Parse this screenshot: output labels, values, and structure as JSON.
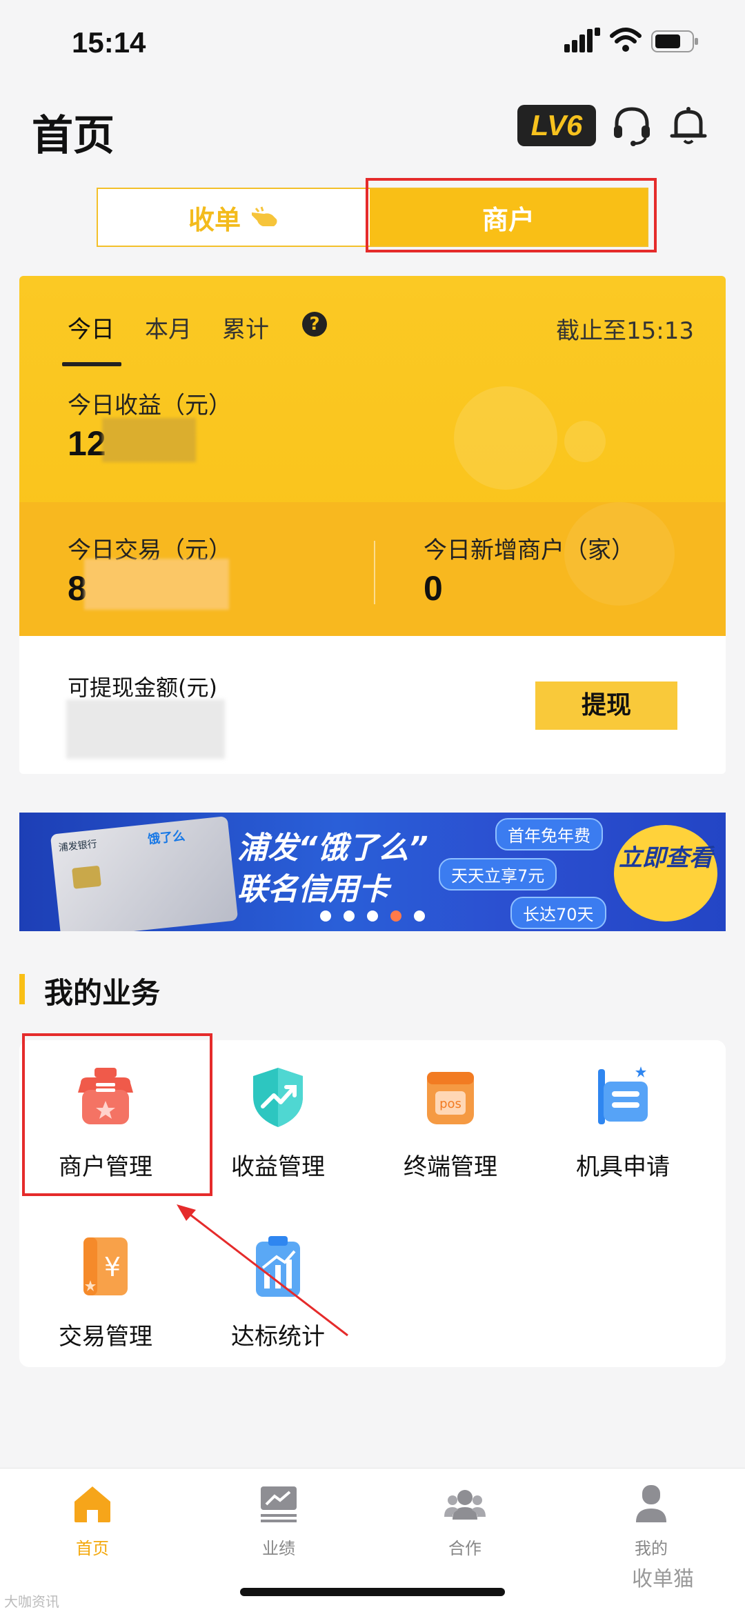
{
  "status_bar": {
    "time": "15:14"
  },
  "header": {
    "title": "首页",
    "level": "LV6"
  },
  "switch": {
    "left_label": "收单",
    "right_label": "商户"
  },
  "stats": {
    "tabs": [
      "今日",
      "本月",
      "累计"
    ],
    "help": "?",
    "deadline": "截止至15:13",
    "today_income_label": "今日收益（元）",
    "today_income_value_visible": "12",
    "today_trade_label": "今日交易（元）",
    "today_trade_value_visible": "8",
    "new_merchants_label": "今日新增商户（家）",
    "new_merchants_value": "0"
  },
  "withdraw": {
    "label": "可提现金额(元)",
    "button": "提现"
  },
  "banner": {
    "title_line1": "浦发“饿了么”",
    "title_line2": "联名信用卡",
    "pill1": "首年免年费",
    "pill2": "天天立享7元",
    "pill3": "长达70天",
    "cta": "立即查看",
    "card_bank": "浦发银行",
    "card_brand": "饿了么"
  },
  "business": {
    "title": "我的业务",
    "items": [
      "商户管理",
      "收益管理",
      "终端管理",
      "机具申请",
      "交易管理",
      "达标统计"
    ]
  },
  "nav": {
    "items": [
      "首页",
      "业绩",
      "合作",
      "我的"
    ]
  },
  "watermark": {
    "left": "大咖资讯",
    "right": "收单猫"
  },
  "colors": {
    "accent": "#f9bf16",
    "highlight_box": "#e52b2b",
    "banner_blue": "#2a5fd8"
  }
}
